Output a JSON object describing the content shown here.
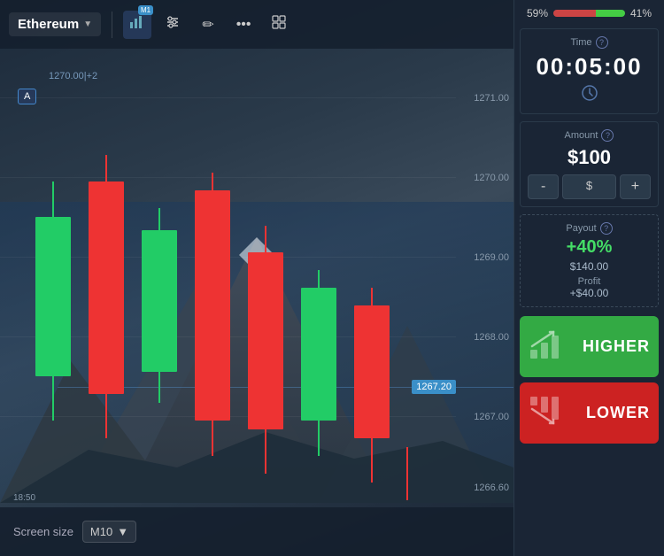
{
  "chart": {
    "asset": "Ethereum",
    "asset_arrow": "▼",
    "timeframe": "M1",
    "y_labels": [
      "1271.00",
      "1270.00",
      "1269.00",
      "1268.00",
      "1267.00",
      "1266.60"
    ],
    "current_price": "1267.20",
    "x_label_left": "18:50",
    "x_data_label": "1270.00|+2",
    "annotation_a": "A",
    "grid_lines_count": 5,
    "screen_size_label": "Screen size",
    "screen_size_value": "M10"
  },
  "toolbar": {
    "chart_icon": "📊",
    "settings_icon": "⚙",
    "draw_icon": "✏",
    "more_icon": "•••",
    "grid_icon": "⊞"
  },
  "panel": {
    "progress_left_pct": "59%",
    "progress_right_pct": "41%",
    "progress_red_width": 59,
    "progress_green_width": 41,
    "time_label": "Time",
    "time_value": "00:05:00",
    "clock_icon": "⊙",
    "amount_label": "Amount",
    "amount_value": "$100",
    "minus_label": "-",
    "currency_label": "$",
    "plus_label": "+",
    "payout_label": "Payout",
    "payout_pct": "+40%",
    "payout_amount": "$140.00",
    "profit_label": "Profit",
    "profit_value": "+$40.00",
    "higher_label": "HIGHER",
    "lower_label": "LOWER"
  }
}
